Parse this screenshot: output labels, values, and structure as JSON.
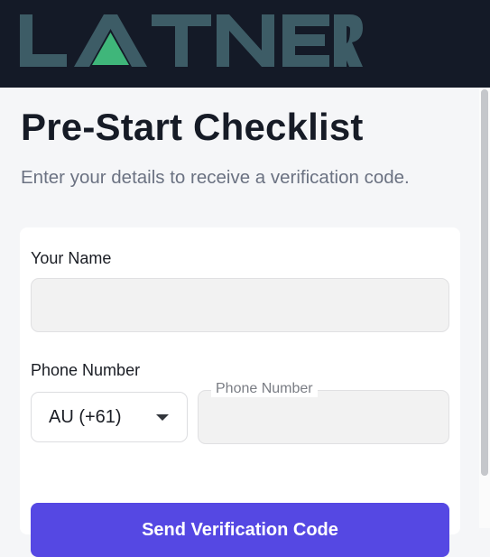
{
  "header": {
    "logo_text": "LATNER",
    "brand_color": "#3d5c66",
    "accent_color": "#3fb67a",
    "background": "#141a27"
  },
  "page": {
    "title": "Pre-Start Checklist",
    "subtitle": "Enter your details to receive a verification code."
  },
  "form": {
    "name_label": "Your Name",
    "name_value": "",
    "phone_label": "Phone Number",
    "country_code": "AU (+61)",
    "phone_placeholder": "Phone Number",
    "phone_value": "",
    "submit_label": "Send Verification Code",
    "submit_color": "#5548e3"
  },
  "icons": {
    "dropdown": "chevron-down-icon"
  }
}
